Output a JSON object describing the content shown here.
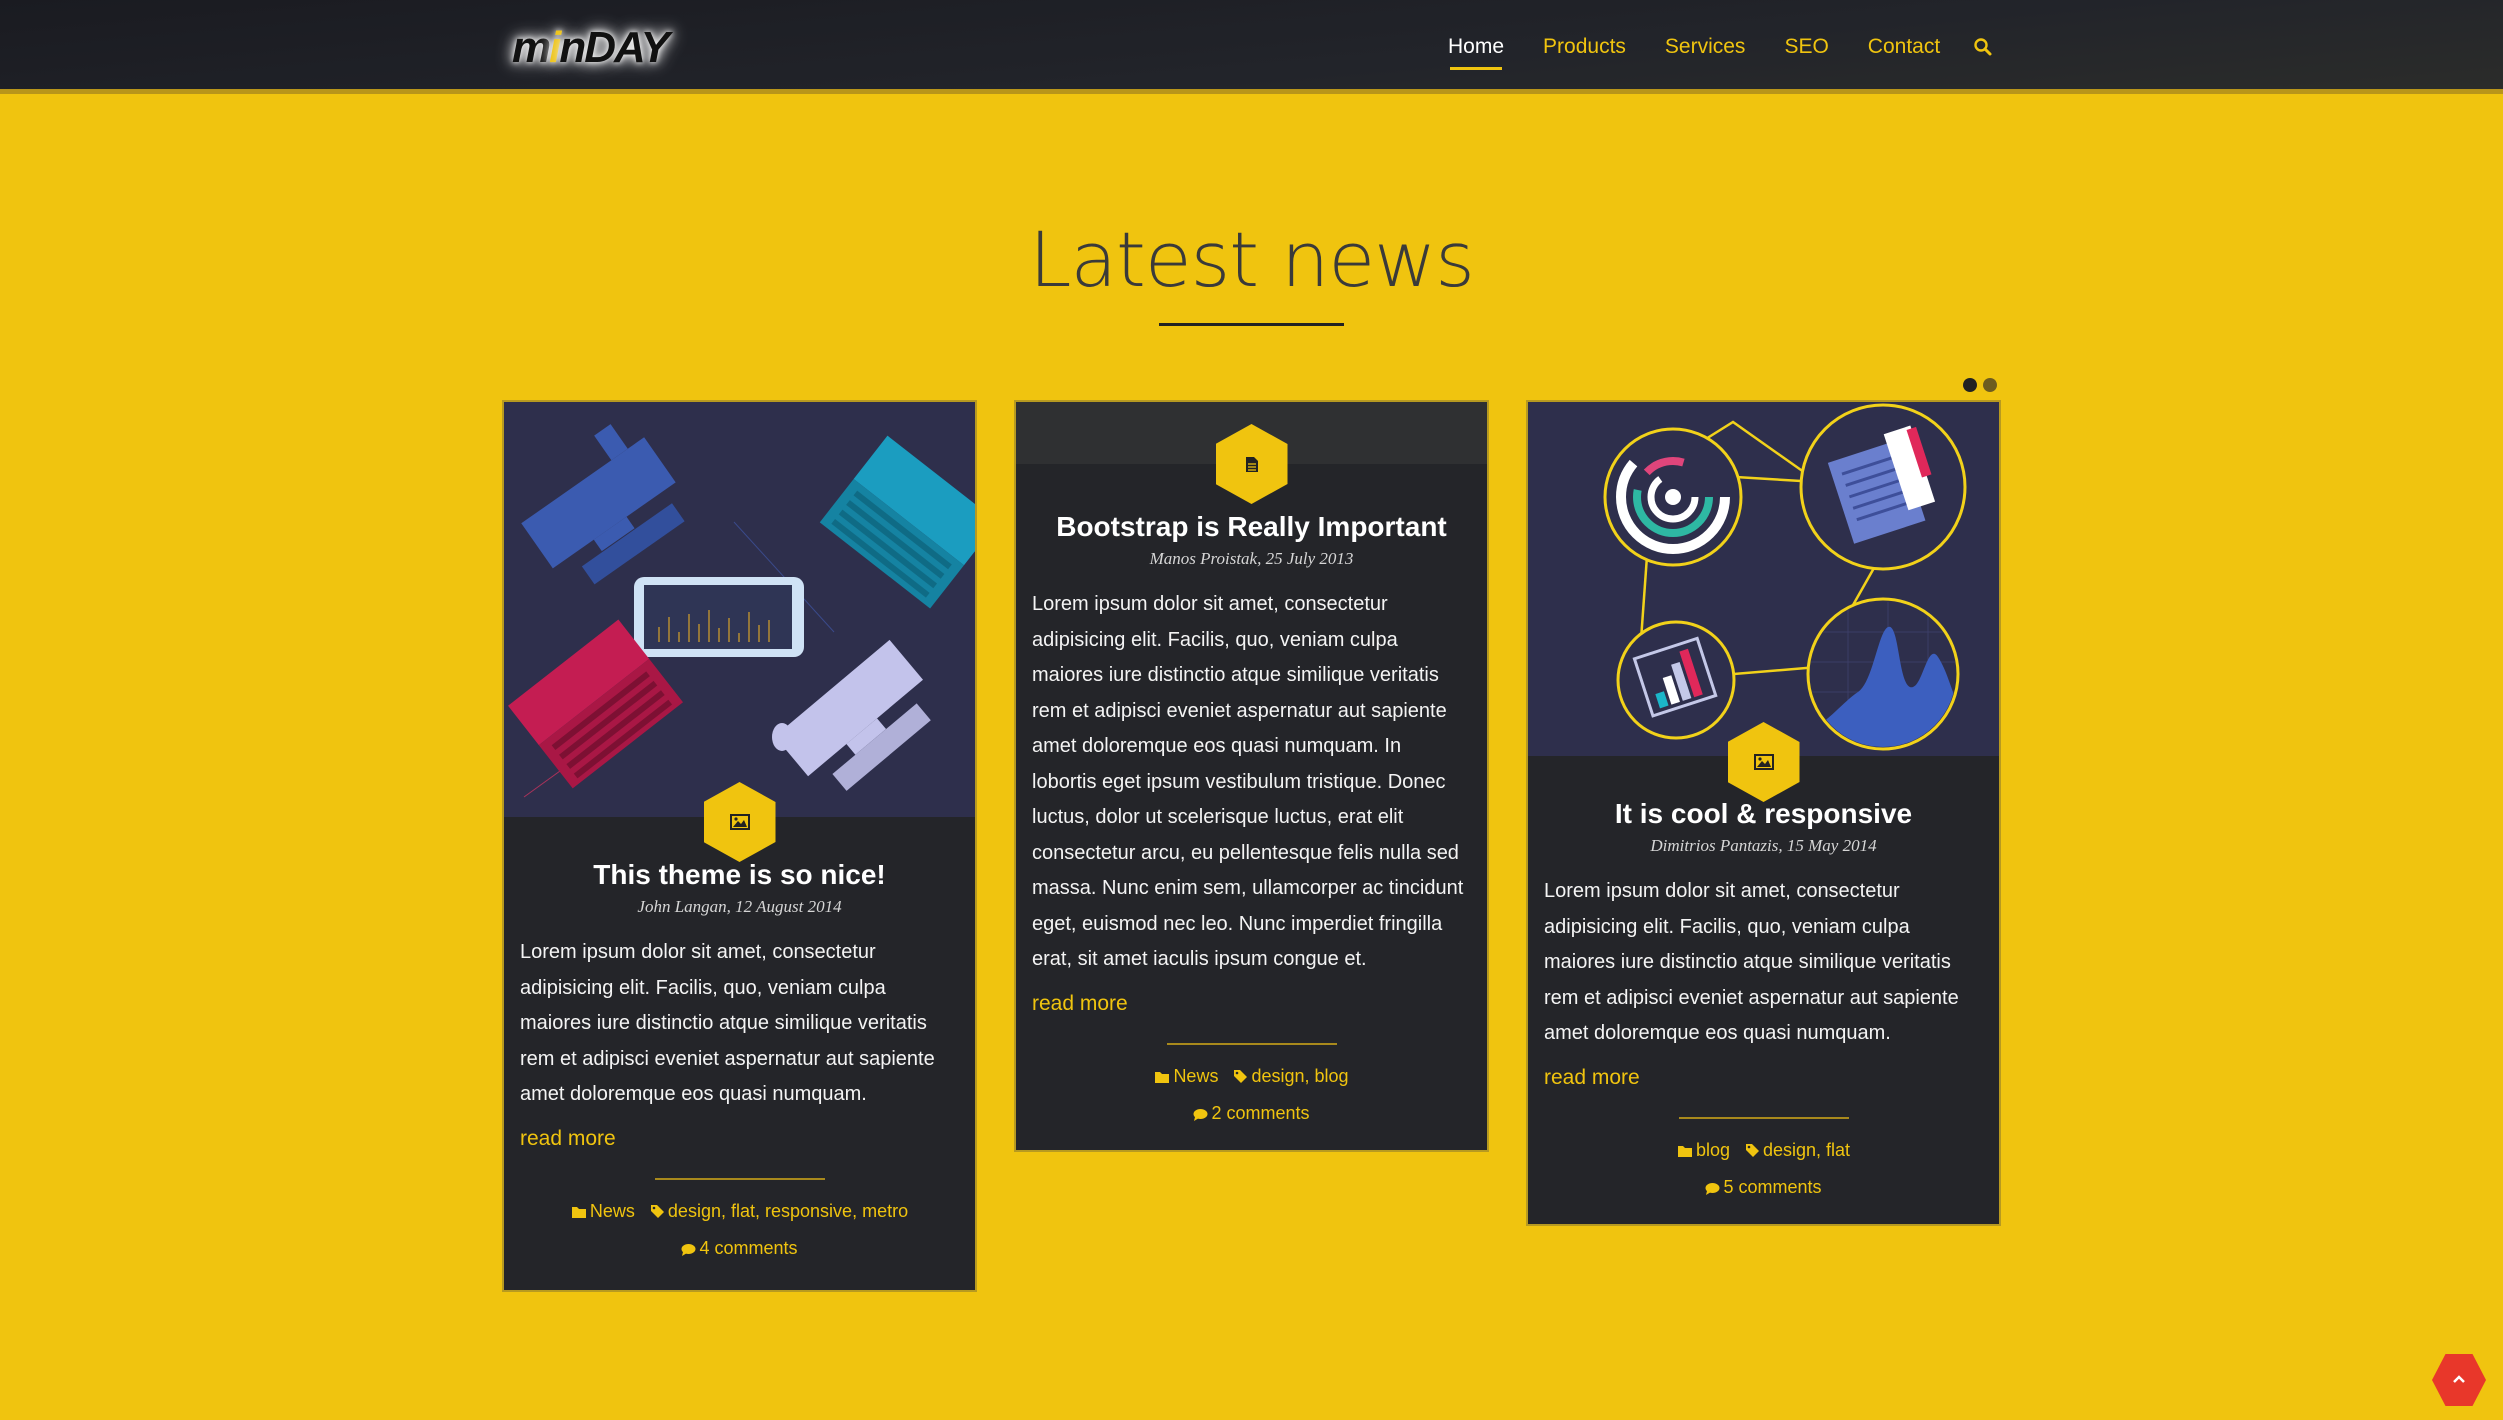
{
  "header": {
    "logo_text_1": "m",
    "logo_text_accent": "i",
    "logo_text_2": "nDAY",
    "nav": [
      {
        "label": "Home"
      },
      {
        "label": "Products"
      },
      {
        "label": "Services"
      },
      {
        "label": "SEO"
      },
      {
        "label": "Contact"
      }
    ],
    "search_icon": "search-icon"
  },
  "section": {
    "title": "Latest news"
  },
  "carousel": {
    "active_index": 0,
    "count": 2
  },
  "colors": {
    "background": "#f0c40f",
    "accent": "#f0c40f",
    "card": "#242529",
    "header": "#1e1f24",
    "scroll_top": "#e8372a"
  },
  "cards": [
    {
      "icon": "image-icon",
      "title": "This theme is so nice!",
      "meta": "John Langan, 12 August 2014",
      "body": "Lorem ipsum dolor sit amet, consectetur adipisicing elit. Facilis, quo, veniam culpa maiores iure distinctio atque similique veritatis rem et adipisci eveniet aspernatur aut sapiente amet doloremque eos quasi numquam.",
      "read_more": "read more",
      "category": "News",
      "tags": [
        "design",
        "flat",
        "responsive",
        "metro"
      ],
      "comments": "4 comments"
    },
    {
      "icon": "document-icon",
      "title": "Bootstrap is Really Important",
      "meta": "Manos Proistak, 25 July 2013",
      "body": "Lorem ipsum dolor sit amet, consectetur adipisicing elit. Facilis, quo, veniam culpa maiores iure distinctio atque similique veritatis rem et adipisci eveniet aspernatur aut sapiente amet doloremque eos quasi numquam. In lobortis eget ipsum vestibulum tristique. Donec luctus, dolor ut scelerisque luctus, erat elit consectetur arcu, eu pellentesque felis nulla sed massa. Nunc enim sem, ullamcorper ac tincidunt eget, euismod nec leo. Nunc imperdiet fringilla erat, sit amet iaculis ipsum congue et.",
      "read_more": "read more",
      "category": "News",
      "tags": [
        "design",
        "blog"
      ],
      "comments": "2 comments"
    },
    {
      "icon": "image-icon",
      "title": "It is cool & responsive",
      "meta": "Dimitrios Pantazis, 15 May 2014",
      "body": "Lorem ipsum dolor sit amet, consectetur adipisicing elit. Facilis, quo, veniam culpa maiores iure distinctio atque similique veritatis rem et adipisci eveniet aspernatur aut sapiente amet doloremque eos quasi numquam.",
      "read_more": "read more",
      "category": "blog",
      "tags": [
        "design",
        "flat"
      ],
      "comments": "5 comments"
    }
  ]
}
